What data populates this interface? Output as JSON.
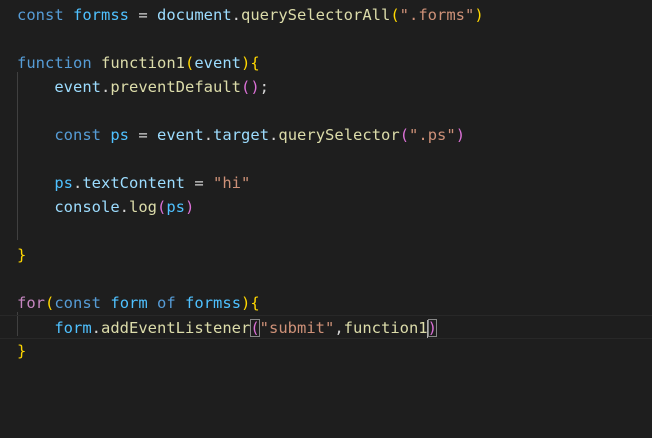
{
  "colors": {
    "background": "#1e1e1e",
    "storage_keyword": "#569cd6",
    "control_keyword": "#c586c0",
    "constant": "#4fc1ff",
    "variable": "#9cdcfe",
    "function": "#dcdcaa",
    "string": "#ce9178",
    "operator": "#d4d4d4",
    "bracket_level1": "#ffd700",
    "bracket_level2": "#da70d6",
    "bracket_level3": "#179fff"
  },
  "code": {
    "lines": [
      {
        "tokens": [
          {
            "t": "const",
            "c": "storage_keyword"
          },
          {
            "t": " ",
            "c": "operator"
          },
          {
            "t": "formss",
            "c": "constant"
          },
          {
            "t": " = ",
            "c": "operator"
          },
          {
            "t": "document",
            "c": "variable"
          },
          {
            "t": ".",
            "c": "operator"
          },
          {
            "t": "querySelectorAll",
            "c": "function"
          },
          {
            "t": "(",
            "c": "bracket_level1"
          },
          {
            "t": "\".forms\"",
            "c": "string"
          },
          {
            "t": ")",
            "c": "bracket_level1"
          }
        ]
      },
      {
        "tokens": []
      },
      {
        "tokens": [
          {
            "t": "function",
            "c": "storage_keyword"
          },
          {
            "t": " ",
            "c": "operator"
          },
          {
            "t": "function1",
            "c": "function"
          },
          {
            "t": "(",
            "c": "bracket_level1"
          },
          {
            "t": "event",
            "c": "variable"
          },
          {
            "t": ")",
            "c": "bracket_level1"
          },
          {
            "t": "{",
            "c": "bracket_level1"
          }
        ]
      },
      {
        "tokens": [
          {
            "t": "    ",
            "c": "operator"
          },
          {
            "t": "event",
            "c": "variable"
          },
          {
            "t": ".",
            "c": "operator"
          },
          {
            "t": "preventDefault",
            "c": "function"
          },
          {
            "t": "()",
            "c": "bracket_level2"
          },
          {
            "t": ";",
            "c": "operator"
          }
        ]
      },
      {
        "tokens": []
      },
      {
        "tokens": [
          {
            "t": "    ",
            "c": "operator"
          },
          {
            "t": "const",
            "c": "storage_keyword"
          },
          {
            "t": " ",
            "c": "operator"
          },
          {
            "t": "ps",
            "c": "constant"
          },
          {
            "t": " = ",
            "c": "operator"
          },
          {
            "t": "event",
            "c": "variable"
          },
          {
            "t": ".",
            "c": "operator"
          },
          {
            "t": "target",
            "c": "variable"
          },
          {
            "t": ".",
            "c": "operator"
          },
          {
            "t": "querySelector",
            "c": "function"
          },
          {
            "t": "(",
            "c": "bracket_level2"
          },
          {
            "t": "\".ps\"",
            "c": "string"
          },
          {
            "t": ")",
            "c": "bracket_level2"
          }
        ]
      },
      {
        "tokens": []
      },
      {
        "tokens": [
          {
            "t": "    ",
            "c": "operator"
          },
          {
            "t": "ps",
            "c": "constant"
          },
          {
            "t": ".",
            "c": "operator"
          },
          {
            "t": "textContent",
            "c": "variable"
          },
          {
            "t": " = ",
            "c": "operator"
          },
          {
            "t": "\"hi\"",
            "c": "string"
          }
        ]
      },
      {
        "tokens": [
          {
            "t": "    ",
            "c": "operator"
          },
          {
            "t": "console",
            "c": "variable"
          },
          {
            "t": ".",
            "c": "operator"
          },
          {
            "t": "log",
            "c": "function"
          },
          {
            "t": "(",
            "c": "bracket_level2"
          },
          {
            "t": "ps",
            "c": "constant"
          },
          {
            "t": ")",
            "c": "bracket_level2"
          }
        ]
      },
      {
        "tokens": []
      },
      {
        "tokens": [
          {
            "t": "}",
            "c": "bracket_level1"
          }
        ]
      },
      {
        "tokens": []
      },
      {
        "tokens": [
          {
            "t": "for",
            "c": "control_keyword"
          },
          {
            "t": "(",
            "c": "bracket_level1"
          },
          {
            "t": "const",
            "c": "storage_keyword"
          },
          {
            "t": " ",
            "c": "operator"
          },
          {
            "t": "form",
            "c": "constant"
          },
          {
            "t": " ",
            "c": "operator"
          },
          {
            "t": "of",
            "c": "storage_keyword"
          },
          {
            "t": " ",
            "c": "operator"
          },
          {
            "t": "formss",
            "c": "constant"
          },
          {
            "t": ")",
            "c": "bracket_level1"
          },
          {
            "t": "{",
            "c": "bracket_level1"
          }
        ]
      },
      {
        "current": true,
        "tokens": [
          {
            "t": "    ",
            "c": "operator"
          },
          {
            "t": "form",
            "c": "constant"
          },
          {
            "t": ".",
            "c": "operator"
          },
          {
            "t": "addEventListener",
            "c": "function"
          },
          {
            "t": "(",
            "c": "bracket_level2",
            "match": true
          },
          {
            "t": "\"submit\"",
            "c": "string"
          },
          {
            "t": ",",
            "c": "operator"
          },
          {
            "t": "function1",
            "c": "function"
          },
          {
            "t": ")",
            "c": "bracket_level2",
            "match": true,
            "cursor_before": true
          }
        ]
      },
      {
        "tokens": [
          {
            "t": "}",
            "c": "bracket_level1"
          }
        ]
      }
    ]
  }
}
